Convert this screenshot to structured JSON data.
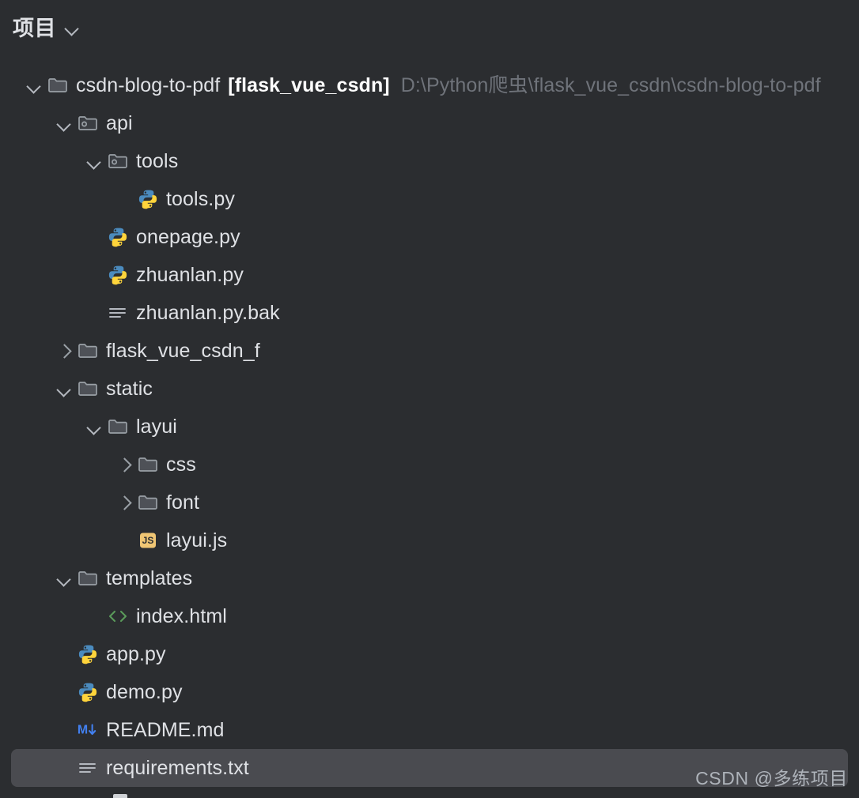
{
  "header": {
    "title": "项目",
    "dropdown_icon": "chevron-down-icon"
  },
  "colors": {
    "background": "#2b2d30",
    "selection": "#4a4b50",
    "text": "#dfe1e5",
    "muted_text": "#6f737a",
    "python_blue": "#4b8bbe",
    "python_yellow": "#ffd43b",
    "js_yellow": "#f0c674",
    "html_green": "#5a9a5a",
    "markdown_blue": "#4280f0",
    "folder_gray": "#9aa0a6"
  },
  "watermark": "CSDN @多练项目",
  "tree": {
    "nodes": [
      {
        "depth": 0,
        "twisty": "expanded",
        "icon": "folder-icon",
        "label": "csdn-blog-to-pdf",
        "module": "[flask_vue_csdn]",
        "path": "D:\\Python爬虫\\flask_vue_csdn\\csdn-blog-to-pdf",
        "selected": false
      },
      {
        "depth": 1,
        "twisty": "expanded",
        "icon": "source-folder-icon",
        "label": "api",
        "selected": false
      },
      {
        "depth": 2,
        "twisty": "expanded",
        "icon": "source-folder-icon",
        "label": "tools",
        "selected": false
      },
      {
        "depth": 3,
        "twisty": "none",
        "icon": "python-file-icon",
        "label": "tools.py",
        "selected": false
      },
      {
        "depth": 2,
        "twisty": "none",
        "icon": "python-file-icon",
        "label": "onepage.py",
        "selected": false
      },
      {
        "depth": 2,
        "twisty": "none",
        "icon": "python-file-icon",
        "label": "zhuanlan.py",
        "selected": false
      },
      {
        "depth": 2,
        "twisty": "none",
        "icon": "text-file-icon",
        "label": "zhuanlan.py.bak",
        "selected": false
      },
      {
        "depth": 1,
        "twisty": "collapsed",
        "icon": "folder-icon",
        "label": "flask_vue_csdn_f",
        "selected": false
      },
      {
        "depth": 1,
        "twisty": "expanded",
        "icon": "folder-icon",
        "label": "static",
        "selected": false
      },
      {
        "depth": 2,
        "twisty": "expanded",
        "icon": "folder-icon",
        "label": "layui",
        "selected": false
      },
      {
        "depth": 3,
        "twisty": "collapsed",
        "icon": "folder-icon",
        "label": "css",
        "selected": false
      },
      {
        "depth": 3,
        "twisty": "collapsed",
        "icon": "folder-icon",
        "label": "font",
        "selected": false
      },
      {
        "depth": 3,
        "twisty": "none",
        "icon": "js-file-icon",
        "label": "layui.js",
        "selected": false
      },
      {
        "depth": 1,
        "twisty": "expanded",
        "icon": "folder-icon",
        "label": "templates",
        "selected": false
      },
      {
        "depth": 2,
        "twisty": "none",
        "icon": "html-file-icon",
        "label": "index.html",
        "selected": false
      },
      {
        "depth": 1,
        "twisty": "none",
        "icon": "python-file-icon",
        "label": "app.py",
        "selected": false
      },
      {
        "depth": 1,
        "twisty": "none",
        "icon": "python-file-icon",
        "label": "demo.py",
        "selected": false
      },
      {
        "depth": 1,
        "twisty": "none",
        "icon": "markdown-file-icon",
        "label": "README.md",
        "selected": false
      },
      {
        "depth": 1,
        "twisty": "none",
        "icon": "text-file-icon",
        "label": "requirements.txt",
        "selected": true
      }
    ]
  }
}
